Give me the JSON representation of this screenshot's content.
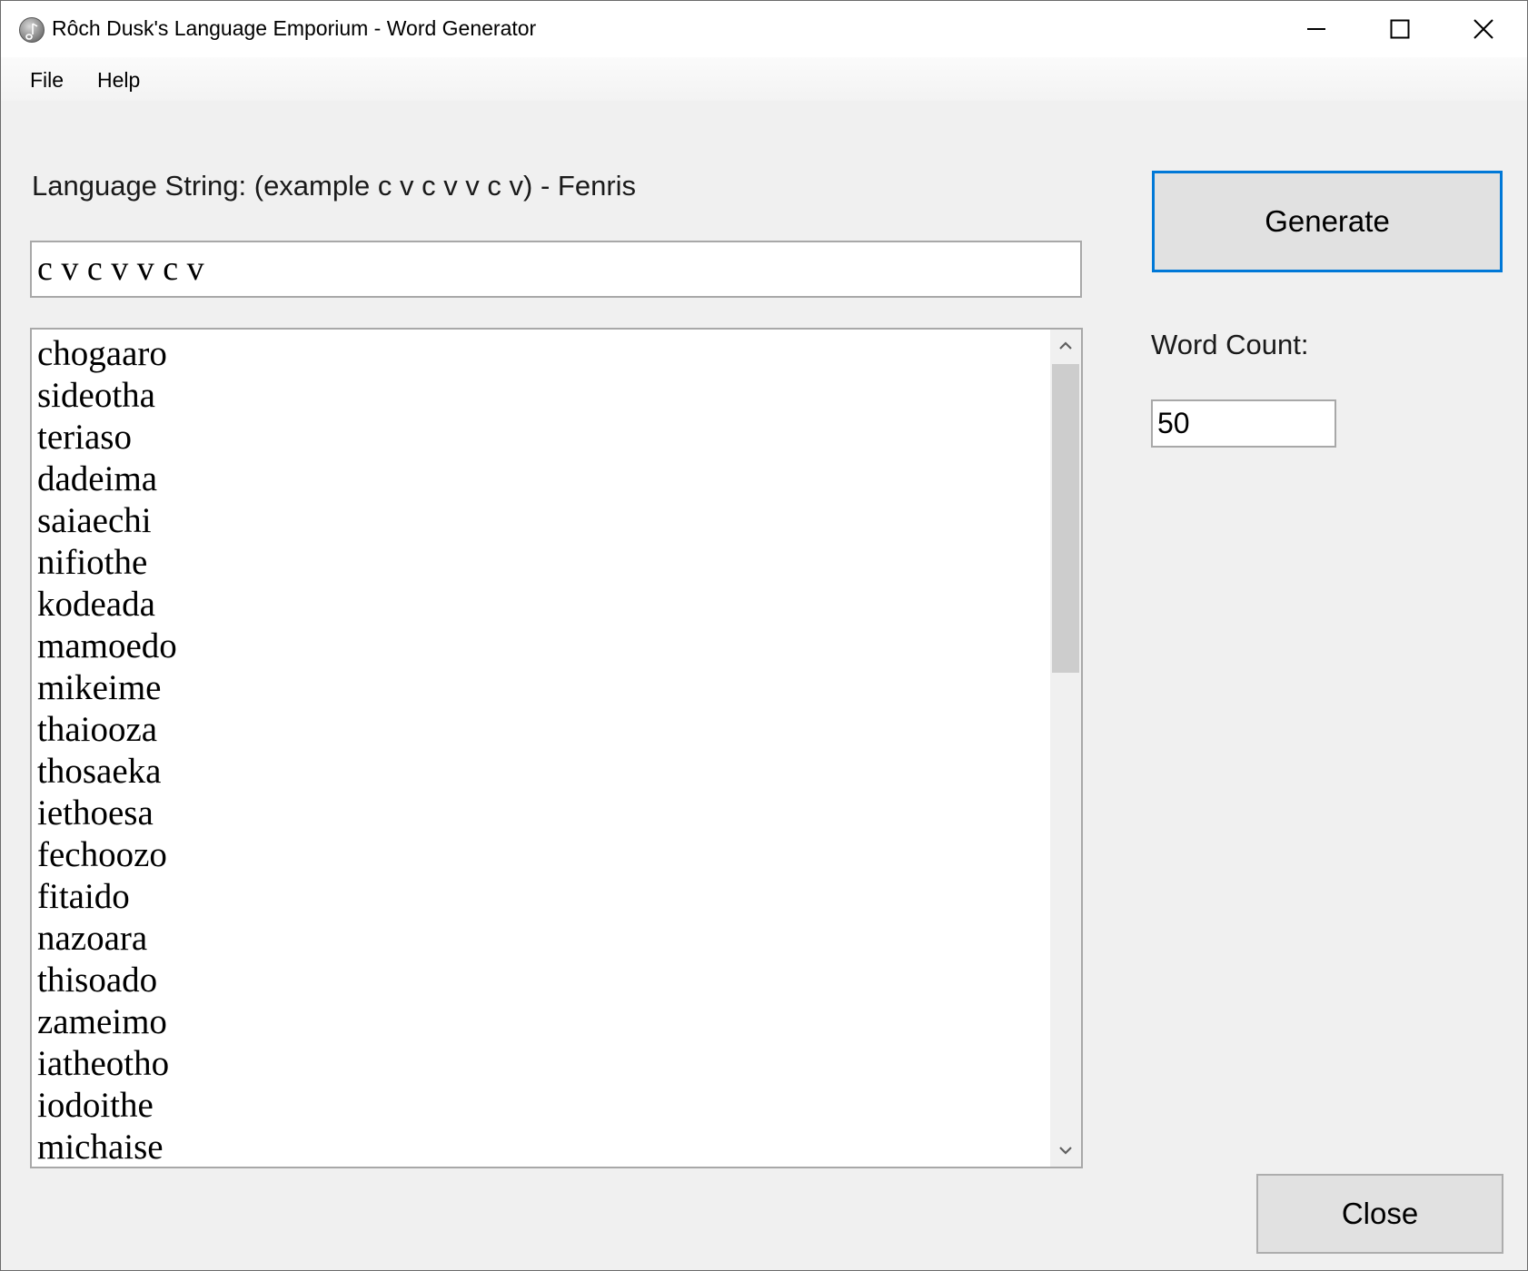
{
  "window": {
    "title": "Rôch Dusk's Language Emporium - Word Generator"
  },
  "menu": {
    "items": [
      "File",
      "Help"
    ]
  },
  "language": {
    "label": "Language String: (example c v c v v c v) - Fenris",
    "value": "c v c v v c v"
  },
  "words": [
    "chogaaro",
    "sideotha",
    "teriaso",
    "dadeima",
    "saiaechi",
    "nifiothe",
    "kodeada",
    "mamoedo",
    "mikeime",
    "thaiooza",
    "thosaeka",
    "iethoesa",
    "fechoozo",
    "fitaido",
    "nazoara",
    "thisoado",
    "zameimo",
    "iatheotho",
    "iodoithe",
    "michaise"
  ],
  "generate": {
    "label": "Generate"
  },
  "word_count": {
    "label": "Word Count:",
    "value": "50"
  },
  "close": {
    "label": "Close"
  },
  "icons": {
    "app": "app-icon",
    "minimize": "minimize-icon",
    "maximize": "maximize-icon",
    "close": "close-icon",
    "scroll_up": "chevron-up-icon",
    "scroll_down": "chevron-down-icon"
  },
  "colors": {
    "accent": "#0078d7",
    "window_bg": "#f0f0f0",
    "button_bg": "#e1e1e1"
  }
}
